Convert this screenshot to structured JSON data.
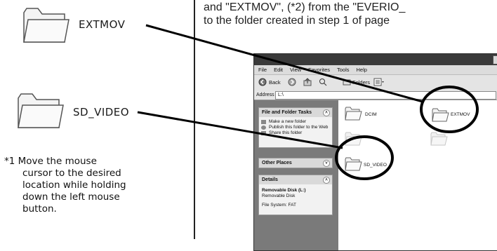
{
  "left": {
    "folders": [
      {
        "name": "EXTMOV"
      },
      {
        "name": "SD_VIDEO"
      }
    ],
    "note_lines": [
      "*1 Move the mouse",
      "cursor to the desired",
      "location while holding",
      "down the left mouse",
      "button."
    ]
  },
  "header": {
    "line1": "and \"EXTMOV\", (*2) from the \"EVERIO_",
    "line2": "to the folder created in step 1 of page"
  },
  "explorer": {
    "menu": [
      "File",
      "Edit",
      "View",
      "Favorites",
      "Tools",
      "Help"
    ],
    "toolbar": {
      "back": "Back",
      "folders": "Folders"
    },
    "address_label": "Address",
    "address_value": "L:\\",
    "file_tasks": {
      "title": "File and Folder Tasks",
      "items": [
        "Make a new folder",
        "Publish this folder to the Web",
        "Share this folder"
      ]
    },
    "other_places": {
      "title": "Other Places"
    },
    "details": {
      "title": "Details",
      "disk_name": "Removable Disk (L:)",
      "disk_type": "Removable Disk",
      "filesystem": "File System: FAT"
    },
    "files": [
      "DCIM",
      "EXTMOV",
      "SD_VIDEO"
    ]
  }
}
